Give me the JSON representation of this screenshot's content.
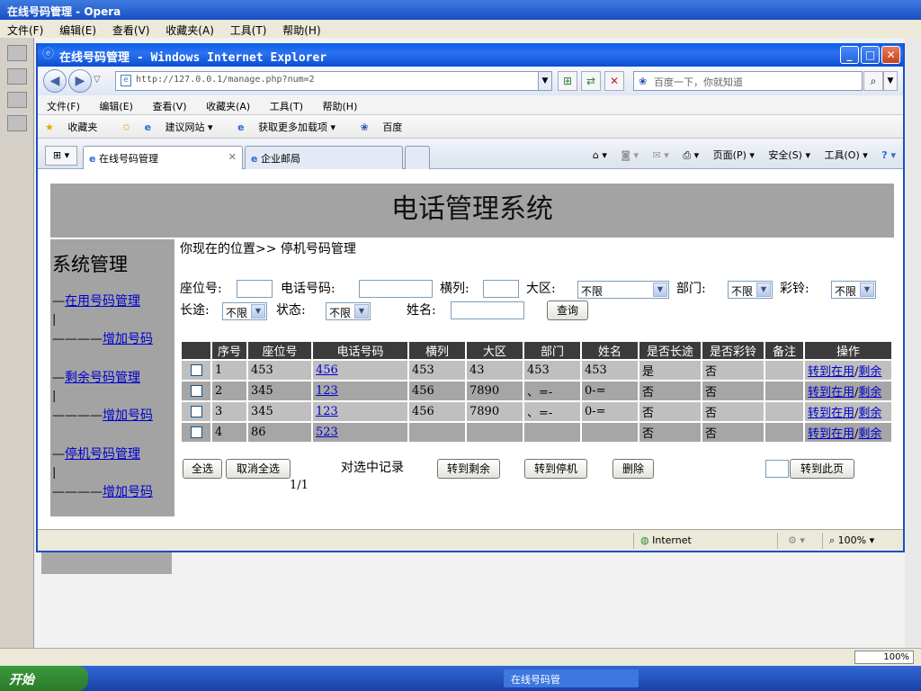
{
  "outer": {
    "title": "在线号码管理 - Opera",
    "menu": [
      "文件(F)",
      "编辑(E)",
      "查看(V)",
      "收藏夹(A)",
      "工具(T)",
      "帮助(H)"
    ],
    "zoom": "100%",
    "taskbar_start": "开始",
    "taskbar_item": "在线号码管"
  },
  "ie": {
    "title": "在线号码管理 - Windows Internet Explorer",
    "address": "http://127.0.0.1/manage.php?num=2",
    "search_placeholder": "百度一下，你就知道",
    "menu": [
      "文件(F)",
      "编辑(E)",
      "查看(V)",
      "收藏夹(A)",
      "工具(T)",
      "帮助(H)"
    ],
    "favorites": {
      "label": "收藏夹",
      "items": [
        "建议网站 ▾",
        "获取更多加载项 ▾",
        "百度"
      ]
    },
    "tabs": [
      {
        "label": "在线号码管理",
        "active": true
      },
      {
        "label": "企业邮局",
        "active": false
      }
    ],
    "commands": [
      "页面(P) ▾",
      "安全(S) ▾",
      "工具(O) ▾"
    ],
    "status": {
      "zone": "Internet",
      "zoom": "100%"
    }
  },
  "page": {
    "header": "电话管理系统",
    "sidebar": {
      "title": "系统管理",
      "items": [
        {
          "prefix": "—",
          "label": "在用号码管理"
        },
        {
          "prefix": "————",
          "label": "增加号码"
        },
        {
          "prefix": "—",
          "label": "剩余号码管理"
        },
        {
          "prefix": "————",
          "label": "增加号码"
        },
        {
          "prefix": "—",
          "label": "停机号码管理"
        },
        {
          "prefix": "————",
          "label": "增加号码"
        }
      ]
    },
    "breadcrumb": "你现在的位置>> 停机号码管理",
    "filters": {
      "seat_label": "座位号:",
      "phone_label": "电话号码:",
      "row_label": "横列:",
      "region_label": "大区:",
      "region_value": "不限",
      "dept_label": "部门:",
      "dept_value": "不限",
      "ring_label": "彩铃:",
      "ring_value": "不限",
      "ld_label": "长途:",
      "ld_value": "不限",
      "state_label": "状态:",
      "state_value": "不限",
      "name_label": "姓名:",
      "query_button": "查询"
    },
    "table": {
      "headers": [
        "",
        "序号",
        "座位号",
        "电话号码",
        "横列",
        "大区",
        "部门",
        "姓名",
        "是否长途",
        "是否彩铃",
        "备注",
        "操作"
      ],
      "rows": [
        {
          "no": "1",
          "seat": "453",
          "phone": "456",
          "row": "453",
          "region": "43",
          "dept": "453",
          "name": "453",
          "ld": "是",
          "ring": "否",
          "note": ""
        },
        {
          "no": "2",
          "seat": "345",
          "phone": "123",
          "row": "456",
          "region": "7890",
          "dept": "、=-",
          "name": "0-=",
          "ld": "否",
          "ring": "否",
          "note": ""
        },
        {
          "no": "3",
          "seat": "345",
          "phone": "123",
          "row": "456",
          "region": "7890",
          "dept": "、=-",
          "name": "0-=",
          "ld": "否",
          "ring": "否",
          "note": ""
        },
        {
          "no": "4",
          "seat": "86",
          "phone": "523",
          "row": "",
          "region": "",
          "dept": "",
          "name": "",
          "ld": "否",
          "ring": "否",
          "note": ""
        }
      ],
      "op_in_use": "转到在用",
      "op_sep": "/",
      "op_remain": "剩余"
    },
    "actions": {
      "select_all": "全选",
      "deselect_all": "取消全选",
      "selected_label": "对选中记录",
      "to_remain": "转到剩余",
      "to_stop": "转到停机",
      "delete": "删除",
      "goto_page": "转到此页"
    },
    "pager": "1/1"
  }
}
